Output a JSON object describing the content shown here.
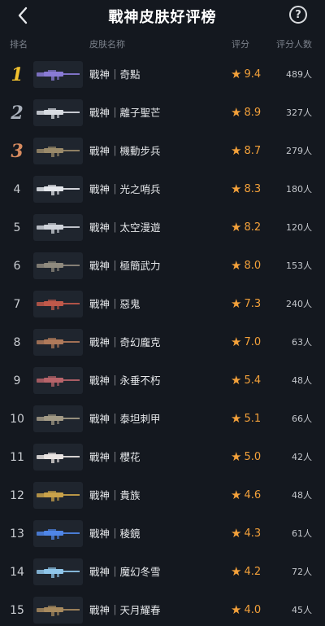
{
  "header": {
    "title": "戰神皮肤好评榜",
    "help_label": "?"
  },
  "columns": {
    "rank": "排名",
    "name": "皮肤名称",
    "score": "评分",
    "count": "评分人数"
  },
  "colors": {
    "background": "#14181f",
    "score": "#f4a13a",
    "gold": "#f2c12e",
    "silver": "#a9b0ba",
    "bronze": "#d88b5f"
  },
  "rows": [
    {
      "rank": "1",
      "medal": "gold",
      "name": "戰神｜奇點",
      "score": "9.4",
      "count": "489人",
      "accent": "#8a7bd6"
    },
    {
      "rank": "2",
      "medal": "silver",
      "name": "戰神｜離子聖芒",
      "score": "8.9",
      "count": "327人",
      "accent": "#d8dce2"
    },
    {
      "rank": "3",
      "medal": "bronze",
      "name": "戰神｜機動步兵",
      "score": "8.7",
      "count": "279人",
      "accent": "#9a8a6a"
    },
    {
      "rank": "4",
      "medal": "",
      "name": "戰神｜光之哨兵",
      "score": "8.3",
      "count": "180人",
      "accent": "#e4e7ec"
    },
    {
      "rank": "5",
      "medal": "",
      "name": "戰神｜太空漫遊",
      "score": "8.2",
      "count": "120人",
      "accent": "#cfd3da"
    },
    {
      "rank": "6",
      "medal": "",
      "name": "戰神｜極簡武力",
      "score": "8.0",
      "count": "153人",
      "accent": "#8f8a7e"
    },
    {
      "rank": "7",
      "medal": "",
      "name": "戰神｜惡鬼",
      "score": "7.3",
      "count": "240人",
      "accent": "#c0594a"
    },
    {
      "rank": "8",
      "medal": "",
      "name": "戰神｜奇幻龐克",
      "score": "7.0",
      "count": "63人",
      "accent": "#b07a5a"
    },
    {
      "rank": "9",
      "medal": "",
      "name": "戰神｜永垂不朽",
      "score": "5.4",
      "count": "48人",
      "accent": "#b8646a"
    },
    {
      "rank": "10",
      "medal": "",
      "name": "戰神｜泰坦刺甲",
      "score": "5.1",
      "count": "66人",
      "accent": "#a29a86"
    },
    {
      "rank": "11",
      "medal": "",
      "name": "戰神｜櫻花",
      "score": "5.0",
      "count": "42人",
      "accent": "#e9e4e2"
    },
    {
      "rank": "12",
      "medal": "",
      "name": "戰神｜貴族",
      "score": "4.6",
      "count": "48人",
      "accent": "#c9a24a"
    },
    {
      "rank": "13",
      "medal": "",
      "name": "戰神｜稜鏡",
      "score": "4.3",
      "count": "61人",
      "accent": "#4f86e8"
    },
    {
      "rank": "14",
      "medal": "",
      "name": "戰神｜魔幻冬雪",
      "score": "4.2",
      "count": "72人",
      "accent": "#8fc6ea"
    },
    {
      "rank": "15",
      "medal": "",
      "name": "戰神｜天月耀春",
      "score": "4.0",
      "count": "45人",
      "accent": "#a78a5e"
    }
  ]
}
